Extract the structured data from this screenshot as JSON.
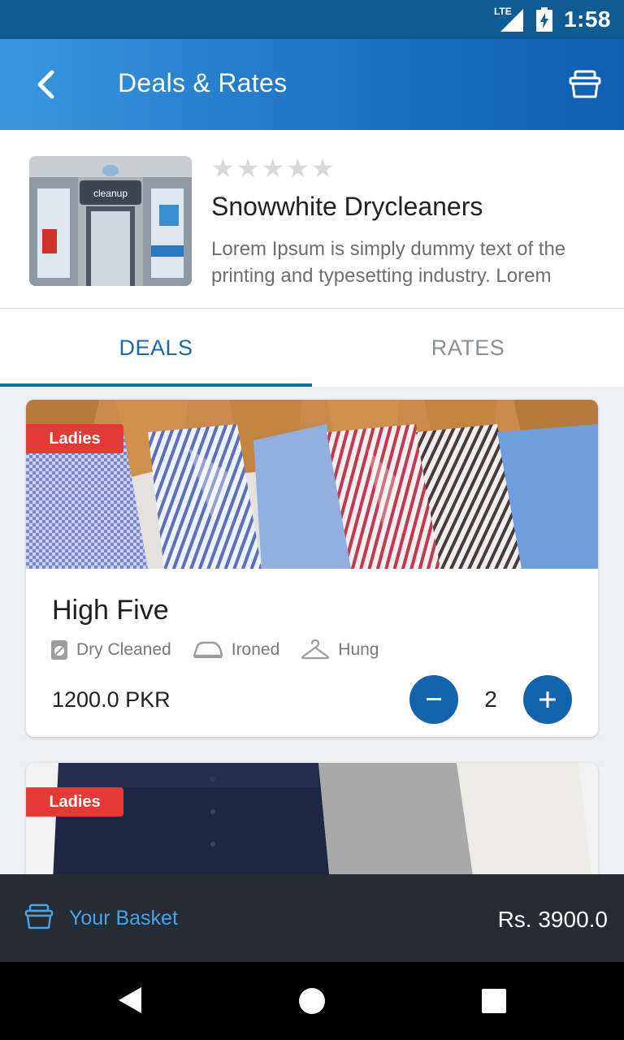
{
  "status_bar": {
    "network_label": "LTE",
    "time": "1:58"
  },
  "app_bar": {
    "title": "Deals & Rates",
    "back_icon": "chevron-left-icon",
    "basket_icon": "basket-icon"
  },
  "shop": {
    "name": "Snowwhite Drycleaners",
    "rating": 0,
    "rating_max": 5,
    "description": "Lorem Ipsum is simply dummy text of the printing and typesetting industry. Lorem",
    "photo_sign": "cleanup"
  },
  "tabs": [
    {
      "label": "DEALS",
      "active": true
    },
    {
      "label": "RATES",
      "active": false
    }
  ],
  "deals": [
    {
      "tag": "Ladies",
      "title": "High Five",
      "services": [
        "Dry Cleaned",
        "Ironed",
        "Hung"
      ],
      "price": "1200.0 PKR",
      "quantity": "2"
    },
    {
      "tag": "Ladies"
    }
  ],
  "basket": {
    "label": "Your Basket",
    "total": "Rs. 3900.0"
  },
  "colors": {
    "primary": "#1b6aa8",
    "accent_red": "#e53935",
    "basket_bar": "#252c33",
    "basket_link": "#4aa3e6"
  }
}
